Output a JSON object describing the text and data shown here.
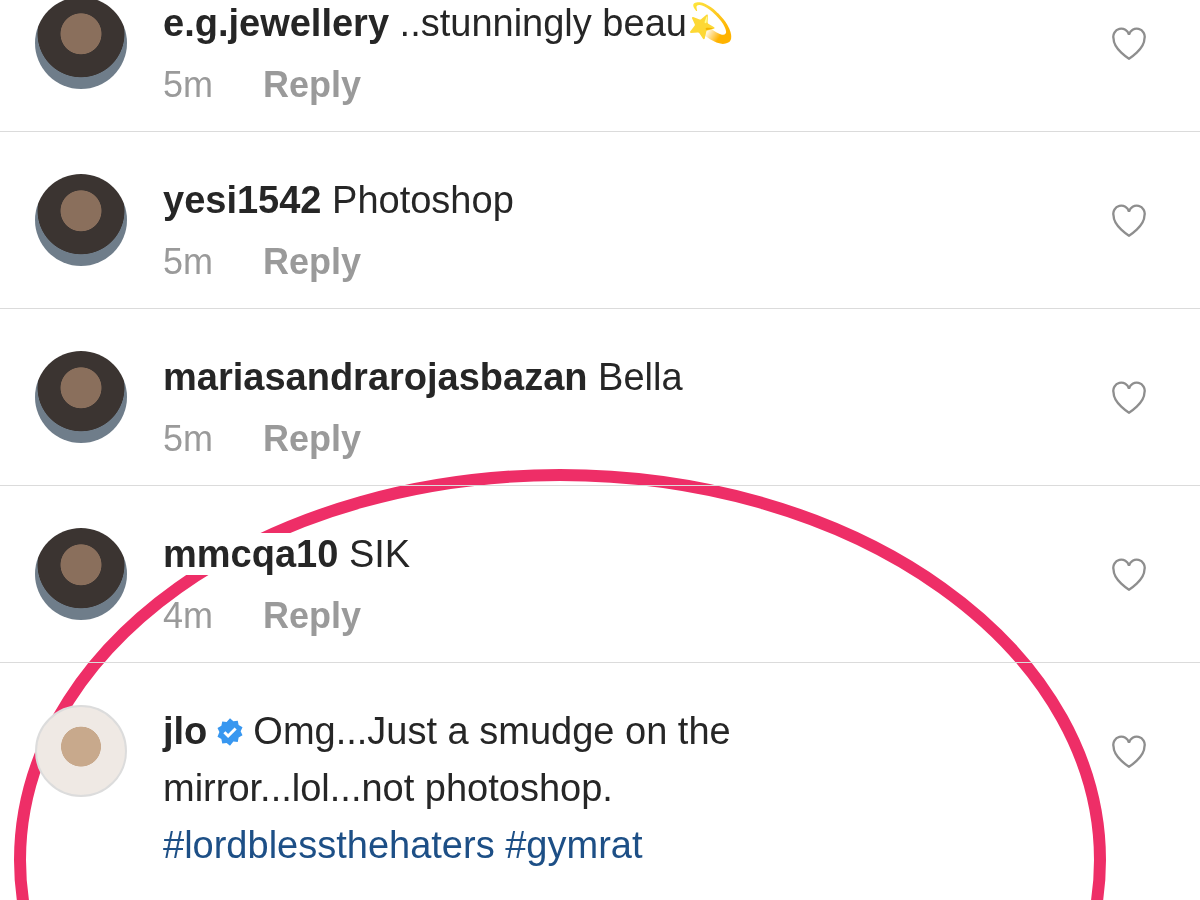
{
  "comments": [
    {
      "username": "e.g.jewellery",
      "verified": false,
      "text": "..stunningly beau💫",
      "time": "5m",
      "reply": "Reply",
      "liked": false
    },
    {
      "username": "yesi1542",
      "verified": false,
      "text": "Photoshop",
      "time": "5m",
      "reply": "Reply",
      "liked": false
    },
    {
      "username": "mariasandrarojasbazan",
      "verified": false,
      "text": "Bella",
      "time": "5m",
      "reply": "Reply",
      "liked": false
    },
    {
      "username": "mmcqa10",
      "verified": false,
      "text": "SIK",
      "time": "4m",
      "reply": "Reply",
      "liked": false
    },
    {
      "username": "jlo",
      "verified": true,
      "text": "Omg...Just a smudge on the mirror...lol...not photoshop.",
      "hashtags": [
        "#lordblessthehaters",
        "#gymrat"
      ],
      "liked": false
    }
  ],
  "highlight": {
    "shown": true
  }
}
